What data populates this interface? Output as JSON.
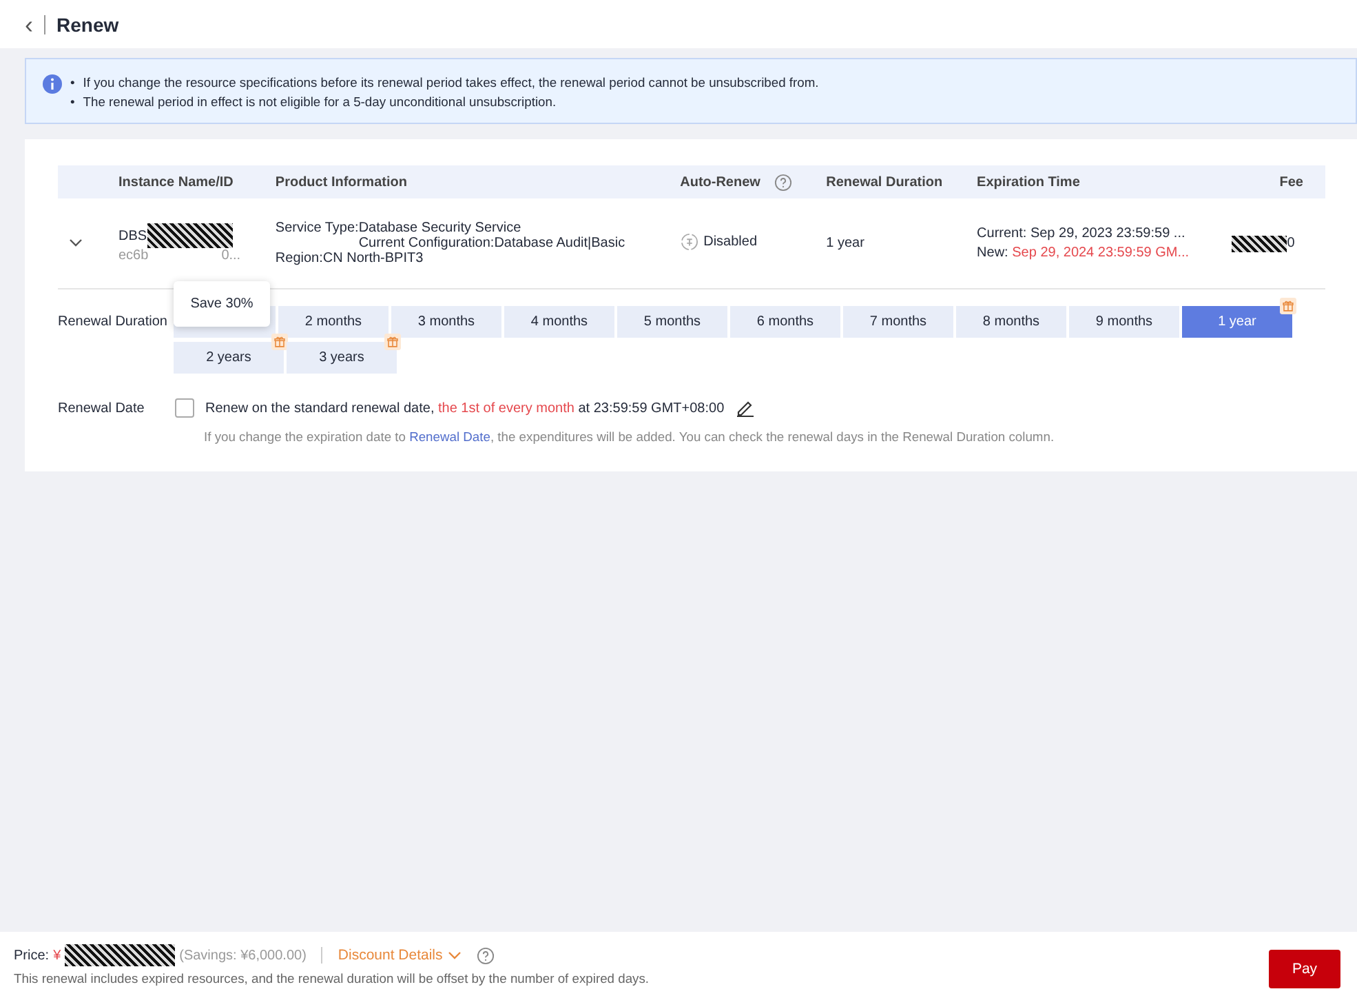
{
  "header": {
    "back_icon": "‹",
    "title": "Renew"
  },
  "notice": [
    {
      "bullet": "•",
      "text": "If you change the resource specifications before its renewal period takes effect, the renewal period cannot be unsubscribed from."
    },
    {
      "bullet": "•",
      "text": "The renewal period in effect is not eligible for a 5-day unconditional unsubscription."
    }
  ],
  "table": {
    "columns": [
      "Instance Name/ID",
      "Product Information",
      "Auto-Renew",
      "Renewal Duration",
      "Expiration Time",
      "Fee"
    ],
    "rows": [
      {
        "expanded": false,
        "name": "DBS",
        "id_start": "ec6b",
        "id_end": "0...",
        "service_type_label": "Service Type:",
        "service_type": "Database Security Service",
        "configuration": "Current Configuration:Database Audit|Basic",
        "region": "Region:CN North-BPIT3",
        "auto_renew": "Disabled",
        "renewal_duration": "1 year",
        "current": "Current: Sep 29, 2023 23:59:59 ...",
        "new_label": "New:",
        "new": "Sep 29, 2024 23:59:59 GM...",
        "fee_end": "0"
      }
    ]
  },
  "renewal_duration": {
    "label": "Renewal Duration",
    "tooltip": "Save 30%",
    "options": [
      {
        "selected": false,
        "gift": false
      },
      {
        "label": "2 months",
        "selected": false,
        "gift": false
      },
      {
        "label": "3 months",
        "selected": false,
        "gift": false
      },
      {
        "label": "4 months",
        "selected": false,
        "gift": false
      },
      {
        "label": "5 months",
        "selected": false,
        "gift": false
      },
      {
        "label": "6 months",
        "selected": false,
        "gift": false
      },
      {
        "label": "7 months",
        "selected": false,
        "gift": false
      },
      {
        "label": "8 months",
        "selected": false,
        "gift": false
      },
      {
        "label": "9 months",
        "selected": false,
        "gift": false
      },
      {
        "label": "1 year",
        "selected": true,
        "gift": true
      },
      {
        "label": "2 years",
        "selected": false,
        "gift": true
      },
      {
        "label": "3 years",
        "selected": false,
        "gift": true
      }
    ]
  },
  "renewal_date": {
    "label": "Renewal Date",
    "checked": false,
    "text_before": "Renew on the standard renewal date, ",
    "text_highlight": "the 1st of every month",
    "text_after": " at 23:59:59 GMT+08:00",
    "hint_before": "If you change the expiration date to ",
    "hint_link": "Renewal Date",
    "hint_after": ", the expenditures will be added. You can check the renewal days in the Renewal Duration column."
  },
  "footer": {
    "price_label": "Price:",
    "currency": "¥",
    "savings": "(Savings: ¥6,000.00)",
    "discount_details": "Discount Details",
    "note": "This renewal includes expired resources, and the renewal duration will be offset by the number of expired days.",
    "pay": "Pay"
  }
}
